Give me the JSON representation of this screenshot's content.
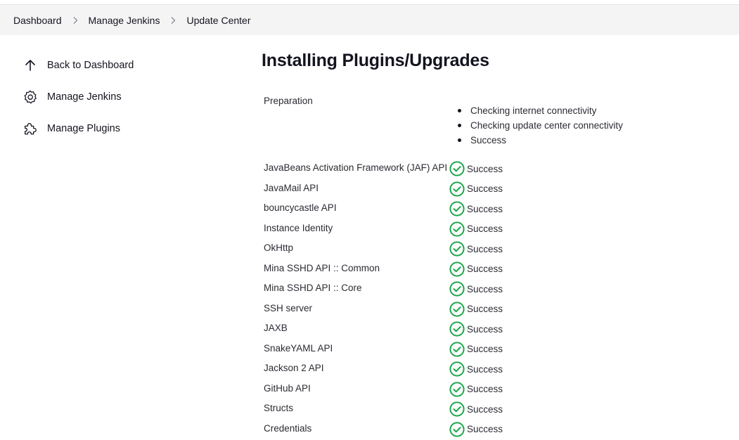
{
  "breadcrumb": {
    "items": [
      "Dashboard",
      "Manage Jenkins",
      "Update Center"
    ]
  },
  "sidebar": {
    "items": [
      {
        "label": "Back to Dashboard",
        "icon": "arrow-up-icon"
      },
      {
        "label": "Manage Jenkins",
        "icon": "gear-icon"
      },
      {
        "label": "Manage Plugins",
        "icon": "puzzle-icon"
      }
    ]
  },
  "main": {
    "title": "Installing Plugins/Upgrades",
    "preparation": {
      "label": "Preparation",
      "steps": [
        "Checking internet connectivity",
        "Checking update center connectivity",
        "Success"
      ]
    },
    "plugins": [
      {
        "name": "JavaBeans Activation Framework (JAF) API",
        "status": "Success"
      },
      {
        "name": "JavaMail API",
        "status": "Success"
      },
      {
        "name": "bouncycastle API",
        "status": "Success"
      },
      {
        "name": "Instance Identity",
        "status": "Success"
      },
      {
        "name": "OkHttp",
        "status": "Success"
      },
      {
        "name": "Mina SSHD API :: Common",
        "status": "Success"
      },
      {
        "name": "Mina SSHD API :: Core",
        "status": "Success"
      },
      {
        "name": "SSH server",
        "status": "Success"
      },
      {
        "name": "JAXB",
        "status": "Success"
      },
      {
        "name": "SnakeYAML API",
        "status": "Success"
      },
      {
        "name": "Jackson 2 API",
        "status": "Success"
      },
      {
        "name": "GitHub API",
        "status": "Success"
      },
      {
        "name": "Structs",
        "status": "Success"
      },
      {
        "name": "Credentials",
        "status": "Success"
      }
    ]
  },
  "colors": {
    "success": "#1ea64b",
    "breadcrumb_bg": "#f4f4f5",
    "text": "#14141f"
  }
}
